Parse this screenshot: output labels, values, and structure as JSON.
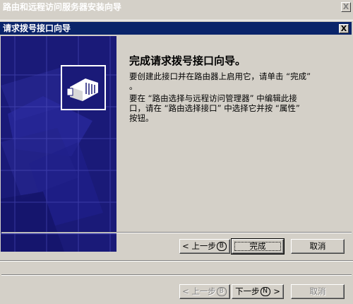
{
  "outer_window": {
    "title": "路由和远程访问服务器安装向导",
    "close_glyph": "X"
  },
  "inner_window": {
    "title": "请求拨号接口向导",
    "close_glyph": "X"
  },
  "content": {
    "heading": "完成请求拨号接口向导。",
    "paragraph1_line1": "要创建此接口并在路由器上启用它，请单击 “完成”",
    "paragraph1_line2": "。",
    "paragraph2_line1": "要在 “路由选择与远程访问管理器” 中编辑此接",
    "paragraph2_line2": "口，请在 “路由选择接口” 中选择它并按 “属性”",
    "paragraph2_line3": "按钮。"
  },
  "inner_buttons": {
    "back_label": "< 上一步",
    "back_mnemonic": "B",
    "back_suffix": "",
    "finish_label": "完成",
    "cancel_label": "取消"
  },
  "outer_buttons": {
    "back_label": "< 上一步",
    "back_mnemonic": "B",
    "next_label": "下一步",
    "next_mnemonic": "N",
    "next_suffix": " >",
    "cancel_label": "取消"
  },
  "colors": {
    "titlebar_active": "#0a246a",
    "banner": "#1a1a78",
    "face": "#d4d0c8"
  }
}
